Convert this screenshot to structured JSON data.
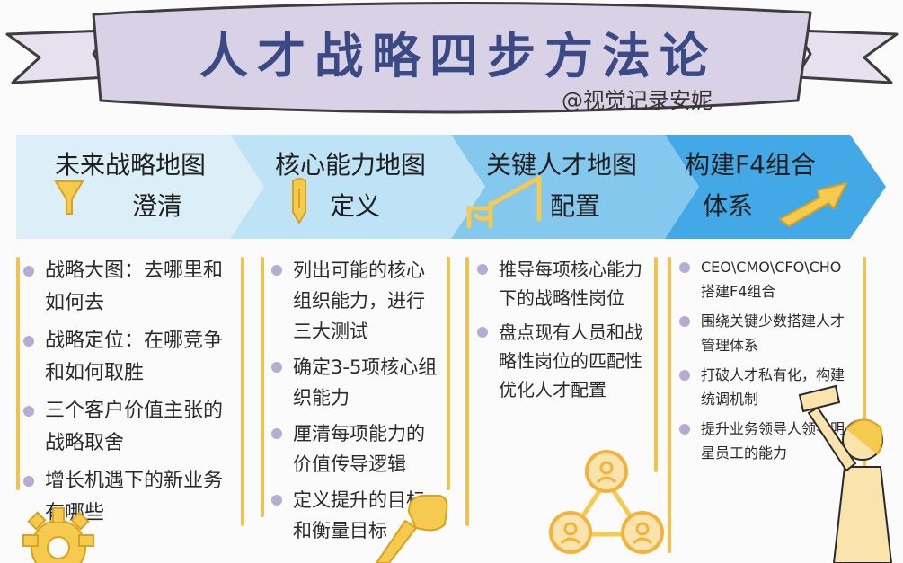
{
  "title": "人才战略四步方法论",
  "credit": "@视觉记录安妮",
  "colors": {
    "title": "#3b4a84",
    "banner": "#d9d2e6",
    "accent": "#f3c24e",
    "bullet": "#b6abd0"
  },
  "steps": [
    {
      "title": "未来战略地图",
      "subtitle": "澄清",
      "icon": "funnel-icon"
    },
    {
      "title": "核心能力地图",
      "subtitle": "定义",
      "icon": "pen-icon"
    },
    {
      "title": "关键人才地图",
      "subtitle": "配置",
      "icon": "crane-icon"
    },
    {
      "title": "构建F4组合",
      "subtitle": "体系",
      "icon": "arrow-up-icon"
    }
  ],
  "columns": [
    {
      "items": [
        "战略大图：去哪里和如何去",
        "战略定位：在哪竞争和如何取胜",
        "三个客户价值主张的战略取舍",
        "增长机遇下的新业务有哪些"
      ]
    },
    {
      "items": [
        "列出可能的核心组织能力，进行三大测试",
        "确定3-5项核心组织能力",
        "厘清每项能力的价值传导逻辑",
        "定义提升的目标和衡量目标"
      ]
    },
    {
      "items": [
        "推导每项核心能力下的战略性岗位",
        "盘点现有人员和战略性岗位的匹配性优化人才配置"
      ]
    },
    {
      "items": [
        "CEO\\CMO\\CFO\\CHO搭建F4组合",
        "围绕关键少数搭建人才管理体系",
        "打破人才私有化，构建统调机制",
        "提升业务领导人领导明星员工的能力"
      ]
    }
  ]
}
